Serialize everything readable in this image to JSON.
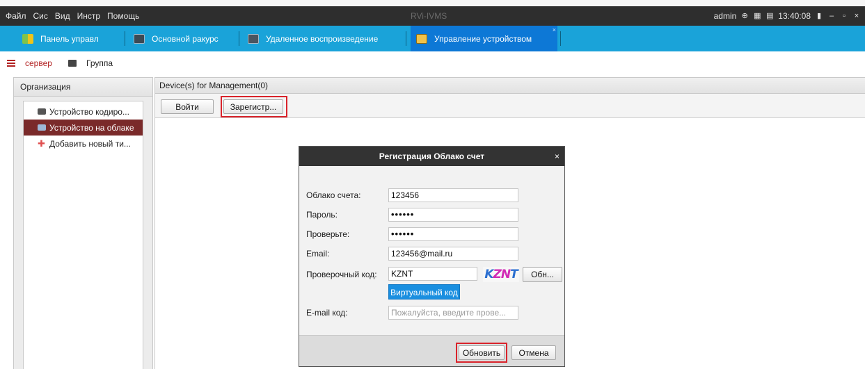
{
  "menubar": {
    "items": [
      "Файл",
      "Сис",
      "Вид",
      "Инстр",
      "Помощь"
    ],
    "app_title": "RVi-IVMS",
    "user": "admin",
    "time": "13:40:08"
  },
  "tabs": [
    {
      "label": "Панель управл",
      "icon": "dashboard-icon"
    },
    {
      "label": "Основной ракурс",
      "icon": "main-view-icon"
    },
    {
      "label": "Удаленное воспроизведение",
      "icon": "playback-icon"
    },
    {
      "label": "Управление устройством",
      "icon": "device-management-icon",
      "active": true
    }
  ],
  "subtabs": [
    {
      "label": "сервер",
      "active": true
    },
    {
      "label": "Группа"
    }
  ],
  "organization": {
    "header": "Организация",
    "items": [
      {
        "label": "Устройство кодиро..."
      },
      {
        "label": "Устройство на облаке",
        "selected": true
      },
      {
        "label": "Добавить новый ти..."
      }
    ]
  },
  "main": {
    "header": "Device(s) for Management(0)",
    "login_button": "Войти",
    "register_button": "Зарегистр..."
  },
  "dialog": {
    "title": "Регистрация Облако счет",
    "fields": {
      "account_label": "Облако счета:",
      "account_value": "123456",
      "password_label": "Пароль:",
      "password_value": "••••••",
      "confirm_label": "Проверьте:",
      "confirm_value": "••••••",
      "email_label": "Email:",
      "email_value": "123456@mail.ru",
      "captcha_label": "Проверочный код:",
      "captcha_value": "KZNT",
      "captcha_image_text": "KZNT",
      "refresh_button": "Обн...",
      "virtual_code_button": "Виртуальный код",
      "email_code_label": "E-mail код:",
      "email_code_placeholder": "Пожалуйста, введите прове..."
    },
    "ok_button": "Обновить",
    "cancel_button": "Отмена"
  },
  "colors": {
    "tabbar": "#1aa3d9",
    "active_tab": "#0d78d6",
    "menubar": "#2e2e2e",
    "selected_item": "#7a2a2a",
    "highlight_box": "#d9232b"
  }
}
